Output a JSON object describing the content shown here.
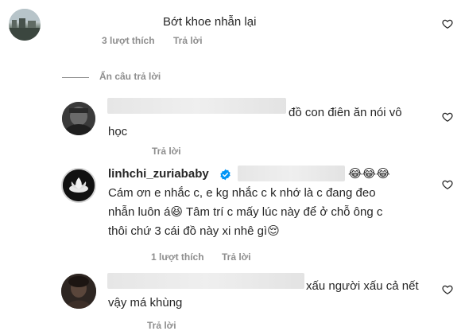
{
  "comments": [
    {
      "text": "Bớt khoe nhẫn lại",
      "likes": "3 lượt thích",
      "reply": "Trả lời",
      "avatar_icon": "avatar-photo-landscape"
    }
  ],
  "hide_replies": "Ẩn câu trả lời",
  "replies": [
    {
      "text_line1": "đồ con điên ăn nói vô",
      "text_line2": "học",
      "reply": "Trả lời",
      "avatar_icon": "avatar-photo-dark"
    },
    {
      "username": "linhchi_zuriababy",
      "verified_icon": "verified-badge-icon",
      "line1": "Cám ơn e nhắc c, e kg nhắc c k nhớ là c đang đeo",
      "line2_text": "nhẫn luôn á",
      "line2_rest": " Tâm trí c mấy lúc này để ở chỗ ông c",
      "line3_text": "thôi chứ 3 cái đồ này xi nhê gì",
      "emoji_laugh": "😂",
      "emoji_grin": "😆",
      "emoji_relieved": "😌",
      "likes": "1 lượt thích",
      "reply": "Trả lời",
      "avatar_icon": "lotus-logo-avatar"
    },
    {
      "text_line1": "xấu người xấu cả nết",
      "text_line2": "vậy má khùng",
      "reply": "Trả lời",
      "avatar_icon": "avatar-photo-person"
    }
  ],
  "colors": {
    "verified": "#0095f6",
    "meta": "#8e8e8e",
    "text": "#262626",
    "ring": "#d4d4d4"
  }
}
